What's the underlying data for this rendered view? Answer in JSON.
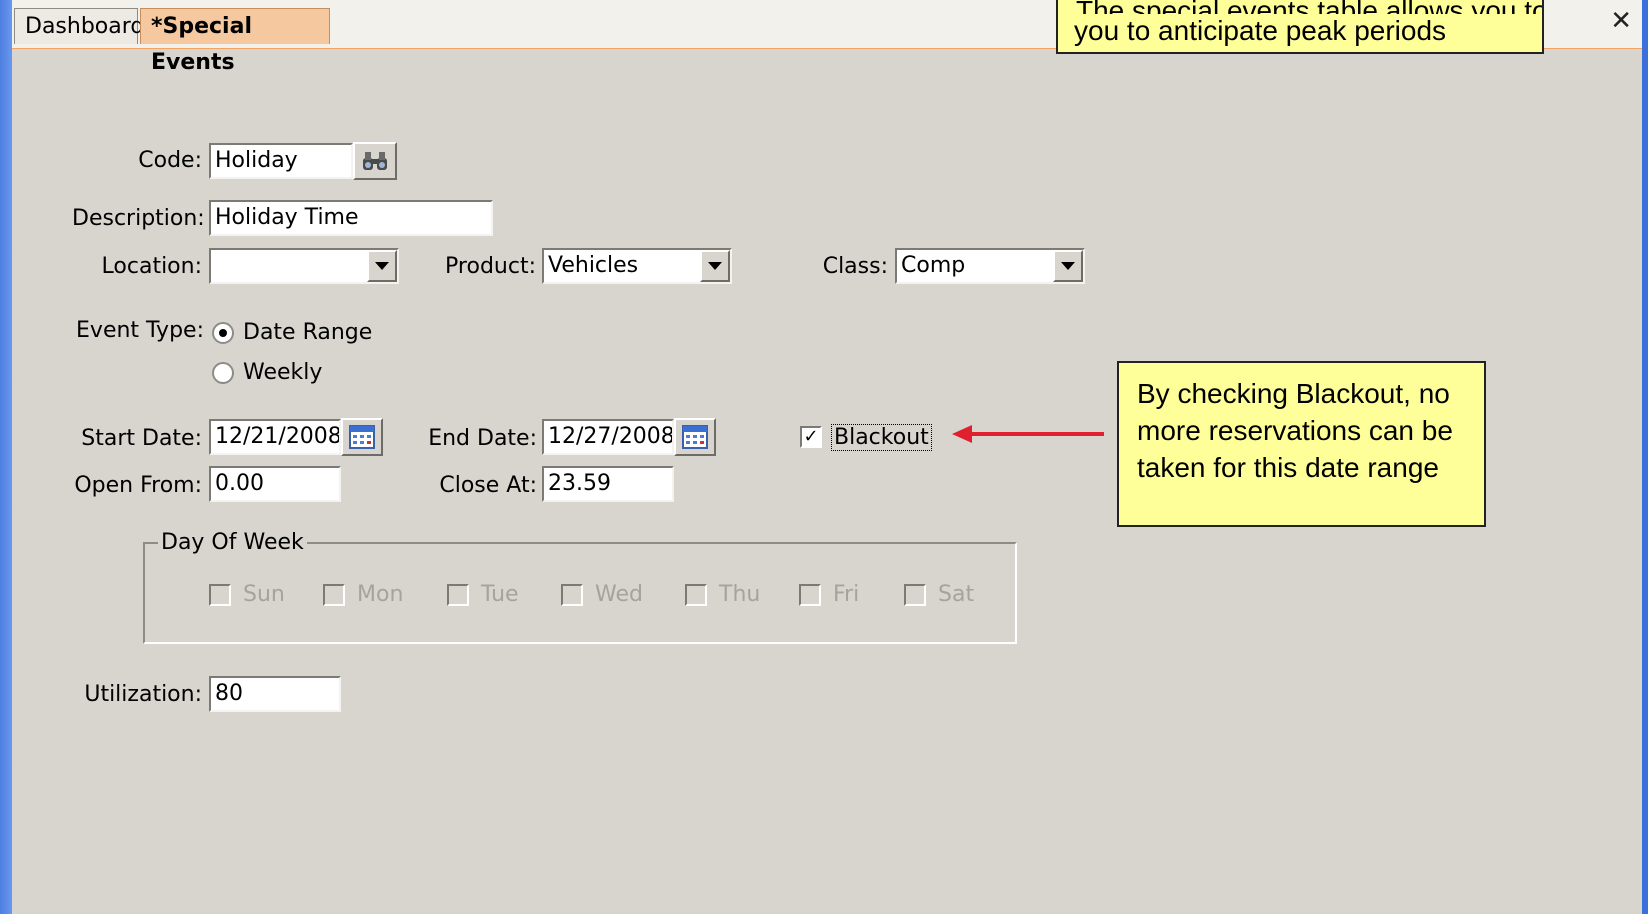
{
  "tabs": [
    {
      "label": "Dashboard"
    },
    {
      "label": "*Special Events"
    }
  ],
  "close_label": "✕",
  "form": {
    "code_label": "Code:",
    "code_value": "Holiday",
    "description_label": "Description:",
    "description_value": "Holiday Time",
    "location_label": "Location:",
    "location_value": "",
    "product_label": "Product:",
    "product_value": "Vehicles",
    "class_label": "Class:",
    "class_value": "Comp",
    "event_type_label": "Event Type:",
    "event_type_options": [
      {
        "label": "Date Range",
        "selected": true
      },
      {
        "label": "Weekly",
        "selected": false
      }
    ],
    "start_date_label": "Start Date:",
    "start_date_value": "12/21/2008",
    "end_date_label": "End Date:",
    "end_date_value": "12/27/2008",
    "blackout_label": "Blackout",
    "blackout_checked": true,
    "open_from_label": "Open From:",
    "open_from_value": "0.00",
    "close_at_label": "Close At:",
    "close_at_value": "23.59",
    "day_of_week_title": "Day Of Week",
    "days": [
      "Sun",
      "Mon",
      "Tue",
      "Wed",
      "Thu",
      "Fri",
      "Sat"
    ],
    "utilization_label": "Utilization:",
    "utilization_value": "80"
  },
  "callouts": {
    "top_text": "The special events table allows you to anticipate peak periods",
    "top_visible_line": "you to anticipate peak periods",
    "blackout_text": "By checking Blackout, no more reservations can be taken for this date range"
  },
  "colors": {
    "background": "#3a6fd8",
    "window": "#d8d5cf",
    "active_tab": "#f6c89f",
    "callout": "#ffff99",
    "arrow": "#e0202e"
  },
  "icons": [
    "binoculars-icon",
    "calendar-icon",
    "dropdown-arrow-icon",
    "close-icon"
  ]
}
